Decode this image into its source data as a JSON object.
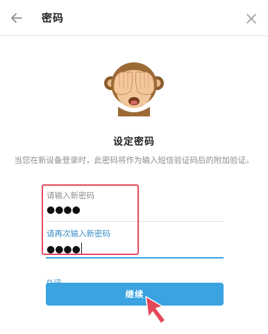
{
  "header": {
    "title": "密码",
    "back_icon": "arrow-left-icon",
    "close_icon": "close-icon"
  },
  "illustration": "see-no-evil-monkey-icon",
  "heading": "设定密码",
  "description": "当您在新设备登录时，此密码将作为输入短信验证码后的附加验证。",
  "form": {
    "new_password": {
      "label": "请输入新密码",
      "value": "●●●●"
    },
    "confirm_password": {
      "label": "请再次输入新密码",
      "value": "●●●●"
    },
    "hint_label": "总词"
  },
  "continue_label": "继续",
  "colors": {
    "accent": "#3aa3e0",
    "focus_label": "#3a8fc8",
    "highlight_box": "#e5475a"
  }
}
